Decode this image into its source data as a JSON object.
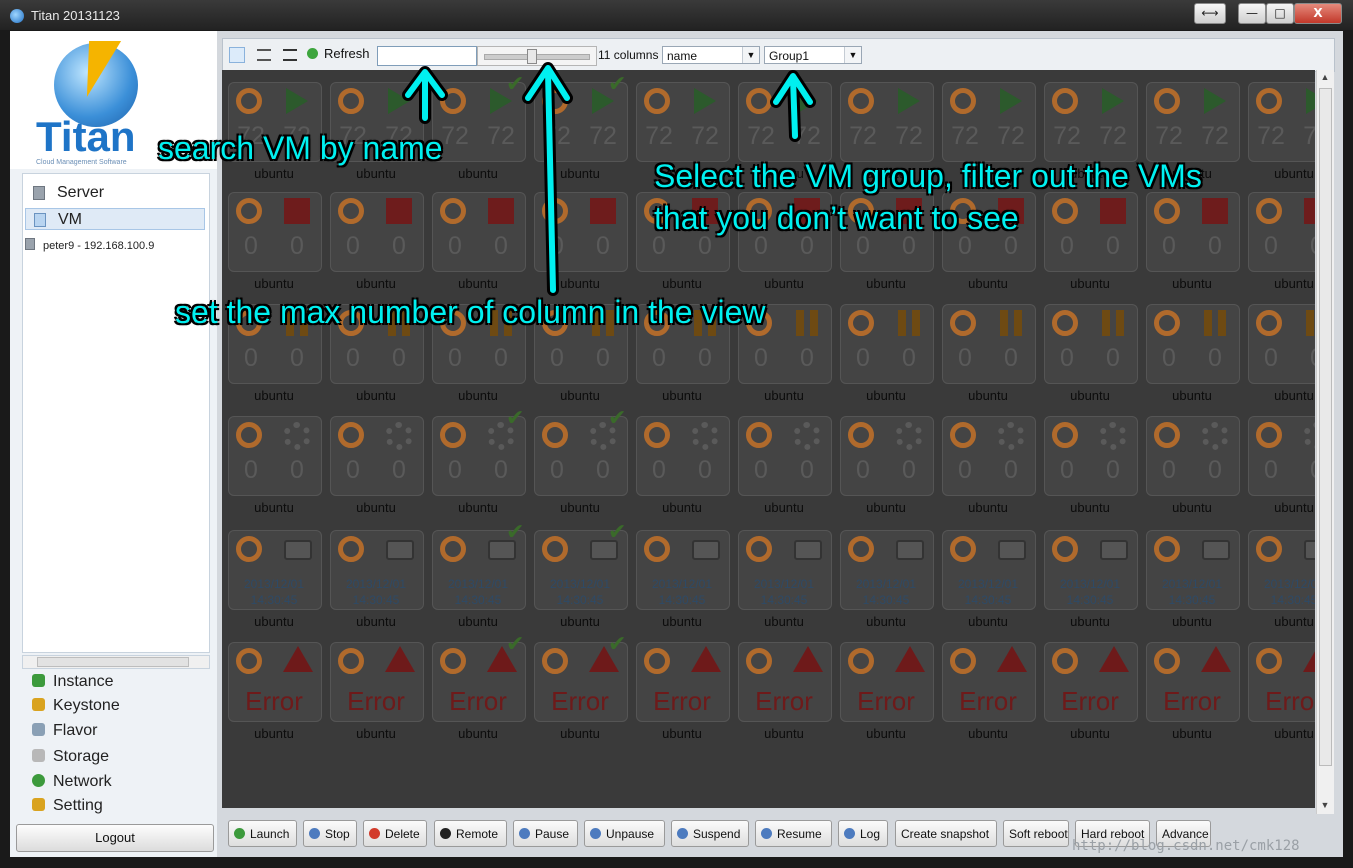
{
  "window": {
    "title": "Titan 20131123",
    "controls": [
      "⟷",
      "—",
      "□",
      "X"
    ]
  },
  "logo": {
    "name": "Titan",
    "tagline": "Cloud Management Software"
  },
  "tree": {
    "items": [
      {
        "label": "Server",
        "icon": "server-icon",
        "selected": false
      },
      {
        "label": "VM",
        "icon": "vm-grid-icon",
        "selected": true
      }
    ],
    "host": "peter9 - 192.168.100.9"
  },
  "nav": {
    "items": [
      {
        "label": "Instance",
        "icon": "puzzle-icon",
        "color": "#3c9a3c"
      },
      {
        "label": "Keystone",
        "icon": "key-icon",
        "color": "#d9a31f"
      },
      {
        "label": "Flavor",
        "icon": "doc-icon",
        "color": "#8aa0b5"
      },
      {
        "label": "Storage",
        "icon": "disk-icon",
        "color": "#b8b8b8"
      },
      {
        "label": "Network",
        "icon": "globe-icon",
        "color": "#3c9a3c"
      },
      {
        "label": "Setting",
        "icon": "pencil-icon",
        "color": "#d9a31f"
      }
    ],
    "logout": "Logout"
  },
  "toolbar": {
    "refresh": "Refresh",
    "search_value": "",
    "columns_label": "11 columns",
    "sort_value": "name",
    "group_value": "Group1",
    "slider_level_fraction": 0.45
  },
  "grid": {
    "vm_label": "ubuntu",
    "rows": [
      {
        "status": "running",
        "v1": "72",
        "v2": "72"
      },
      {
        "status": "stopped",
        "v1": "0",
        "v2": "0"
      },
      {
        "status": "paused",
        "v1": "0",
        "v2": "0"
      },
      {
        "status": "busy",
        "v1": "0",
        "v2": "0"
      },
      {
        "status": "snapshot",
        "date": "2013/12/01",
        "time": "14:30:45"
      },
      {
        "status": "error",
        "text": "Error"
      }
    ],
    "checked_columns": [
      2,
      3
    ]
  },
  "actions": [
    {
      "label": "Launch",
      "icon": "launch-icon",
      "color": "#3c9a3c"
    },
    {
      "label": "Stop",
      "icon": "stop-icon",
      "color": "#4d7bbf"
    },
    {
      "label": "Delete",
      "icon": "delete-icon",
      "color": "#d23b2b"
    },
    {
      "label": "Remote",
      "icon": "terminal-icon",
      "color": "#222222"
    },
    {
      "label": "Pause",
      "icon": "pause-icon",
      "color": "#4d7bbf"
    },
    {
      "label": "Unpause",
      "icon": "unpause-icon",
      "color": "#4d7bbf"
    },
    {
      "label": "Suspend",
      "icon": "suspend-icon",
      "color": "#4d7bbf"
    },
    {
      "label": "Resume",
      "icon": "resume-icon",
      "color": "#4d7bbf"
    },
    {
      "label": "Log",
      "icon": "log-icon",
      "color": "#4d7bbf"
    },
    {
      "label": "Create snapshot",
      "icon": "",
      "color": ""
    },
    {
      "label": "Soft reboot",
      "icon": "",
      "color": ""
    },
    {
      "label": "Hard reboot",
      "icon": "",
      "color": ""
    },
    {
      "label": "Advance",
      "icon": "",
      "color": ""
    }
  ],
  "annotations": {
    "search": "search VM by name",
    "columns": "set the max number of column in the view",
    "group_line1": "Select the VM group, filter out the VMs",
    "group_line2": "that you don’t want to see"
  },
  "watermark": "http://blog.csdn.net/cmk128",
  "colors": {
    "annotation": "#00f0f0",
    "overlay_dark": "#3a3a3a"
  }
}
